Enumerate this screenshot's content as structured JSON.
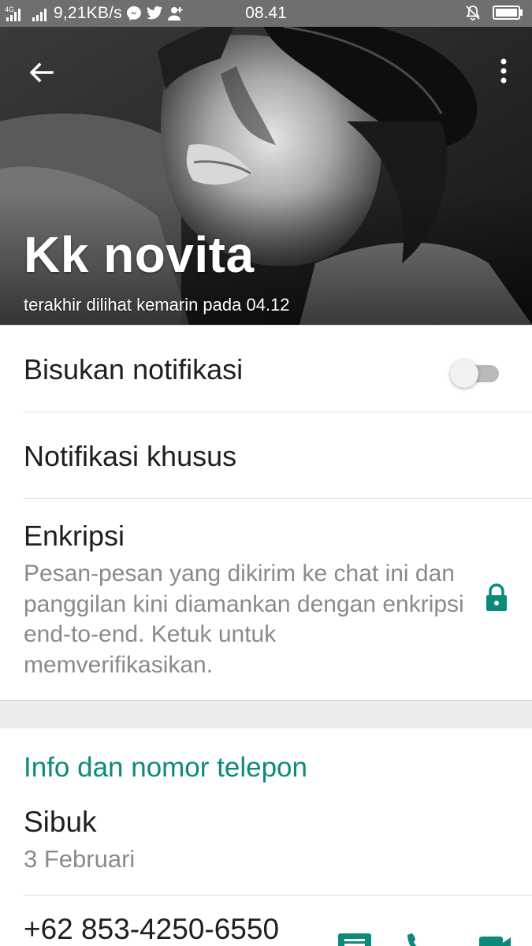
{
  "status_bar": {
    "network_label": "4G",
    "net_speed": "9,21KB/s",
    "time": "08.41",
    "notification_icons": [
      "messenger-icon",
      "twitter-icon",
      "person-add-icon"
    ],
    "right_icons": [
      "bell-off-icon",
      "battery-icon"
    ]
  },
  "header": {
    "back_icon": "arrow-back-icon",
    "menu_icon": "more-vert-icon",
    "contact_name": "Kk novita",
    "last_seen": "terakhir dilihat kemarin pada 04.12"
  },
  "settings": {
    "mute_label": "Bisukan notifikasi",
    "mute_enabled": false,
    "custom_notif_label": "Notifikasi khusus",
    "encryption_label": "Enkripsi",
    "encryption_desc": "Pesan-pesan yang dikirim ke chat ini dan panggilan kini diamankan dengan enkripsi end-to-end. Ketuk untuk memverifikasikan.",
    "encryption_icon": "lock-icon"
  },
  "info": {
    "section_title": "Info dan nomor telepon",
    "about_text": "Sibuk",
    "about_date": "3 Februari",
    "phone_number": "+62 853-4250-6550",
    "action_icons": [
      "message-icon",
      "call-icon",
      "video-call-icon"
    ]
  },
  "colors": {
    "accent": "#0b8a7a",
    "status_bar": "#6f6f6f",
    "secondary_text": "#8a8a8a",
    "divider": "#dedede"
  }
}
